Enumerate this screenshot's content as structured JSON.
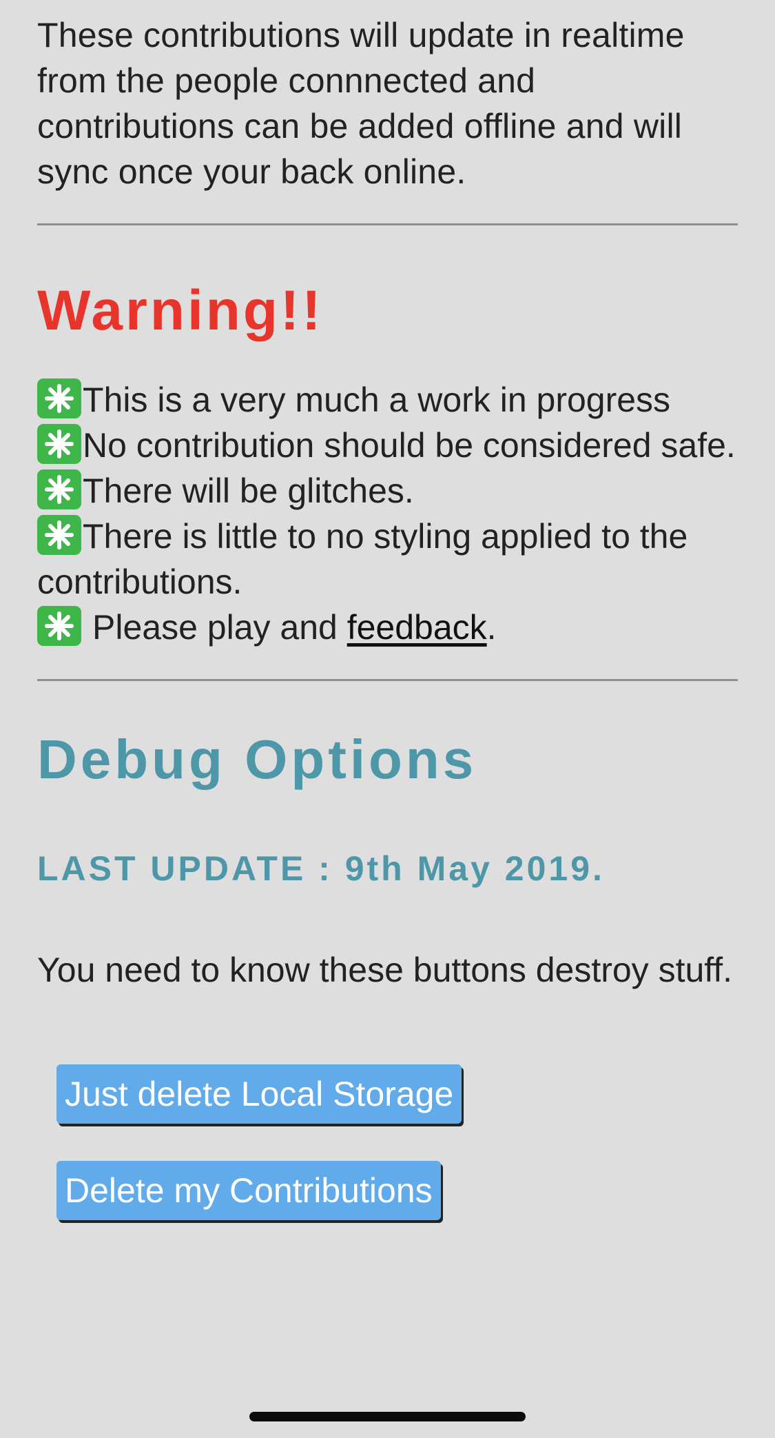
{
  "intro": {
    "text": "These contributions will update in realtime from the people connnected and contributions can be added offline and will sync once your back online."
  },
  "warning": {
    "title": "Warning!!",
    "bullet_icon": "eight-spoked-asterisk-icon",
    "bullet_color": "#3fb64a",
    "items": [
      "This is a very much a work in progress",
      "No contribution should be considered safe.",
      "There will be glitches.",
      "There is little to no styling applied to the contributions."
    ],
    "feedback_prefix": "Please play and ",
    "feedback_link": "feedback",
    "feedback_suffix": "."
  },
  "debug": {
    "title": "Debug Options",
    "last_update": "LAST UPDATE : 9th May 2019.",
    "note": "You need to know these buttons destroy stuff.",
    "buttons": {
      "delete_local_storage": "Just delete Local Storage",
      "delete_contributions": "Delete my Contributions"
    }
  },
  "colors": {
    "background": "#dedede",
    "warning_title": "#e8352b",
    "debug_accent": "#4d97a8",
    "button_bg": "#62abeb"
  }
}
